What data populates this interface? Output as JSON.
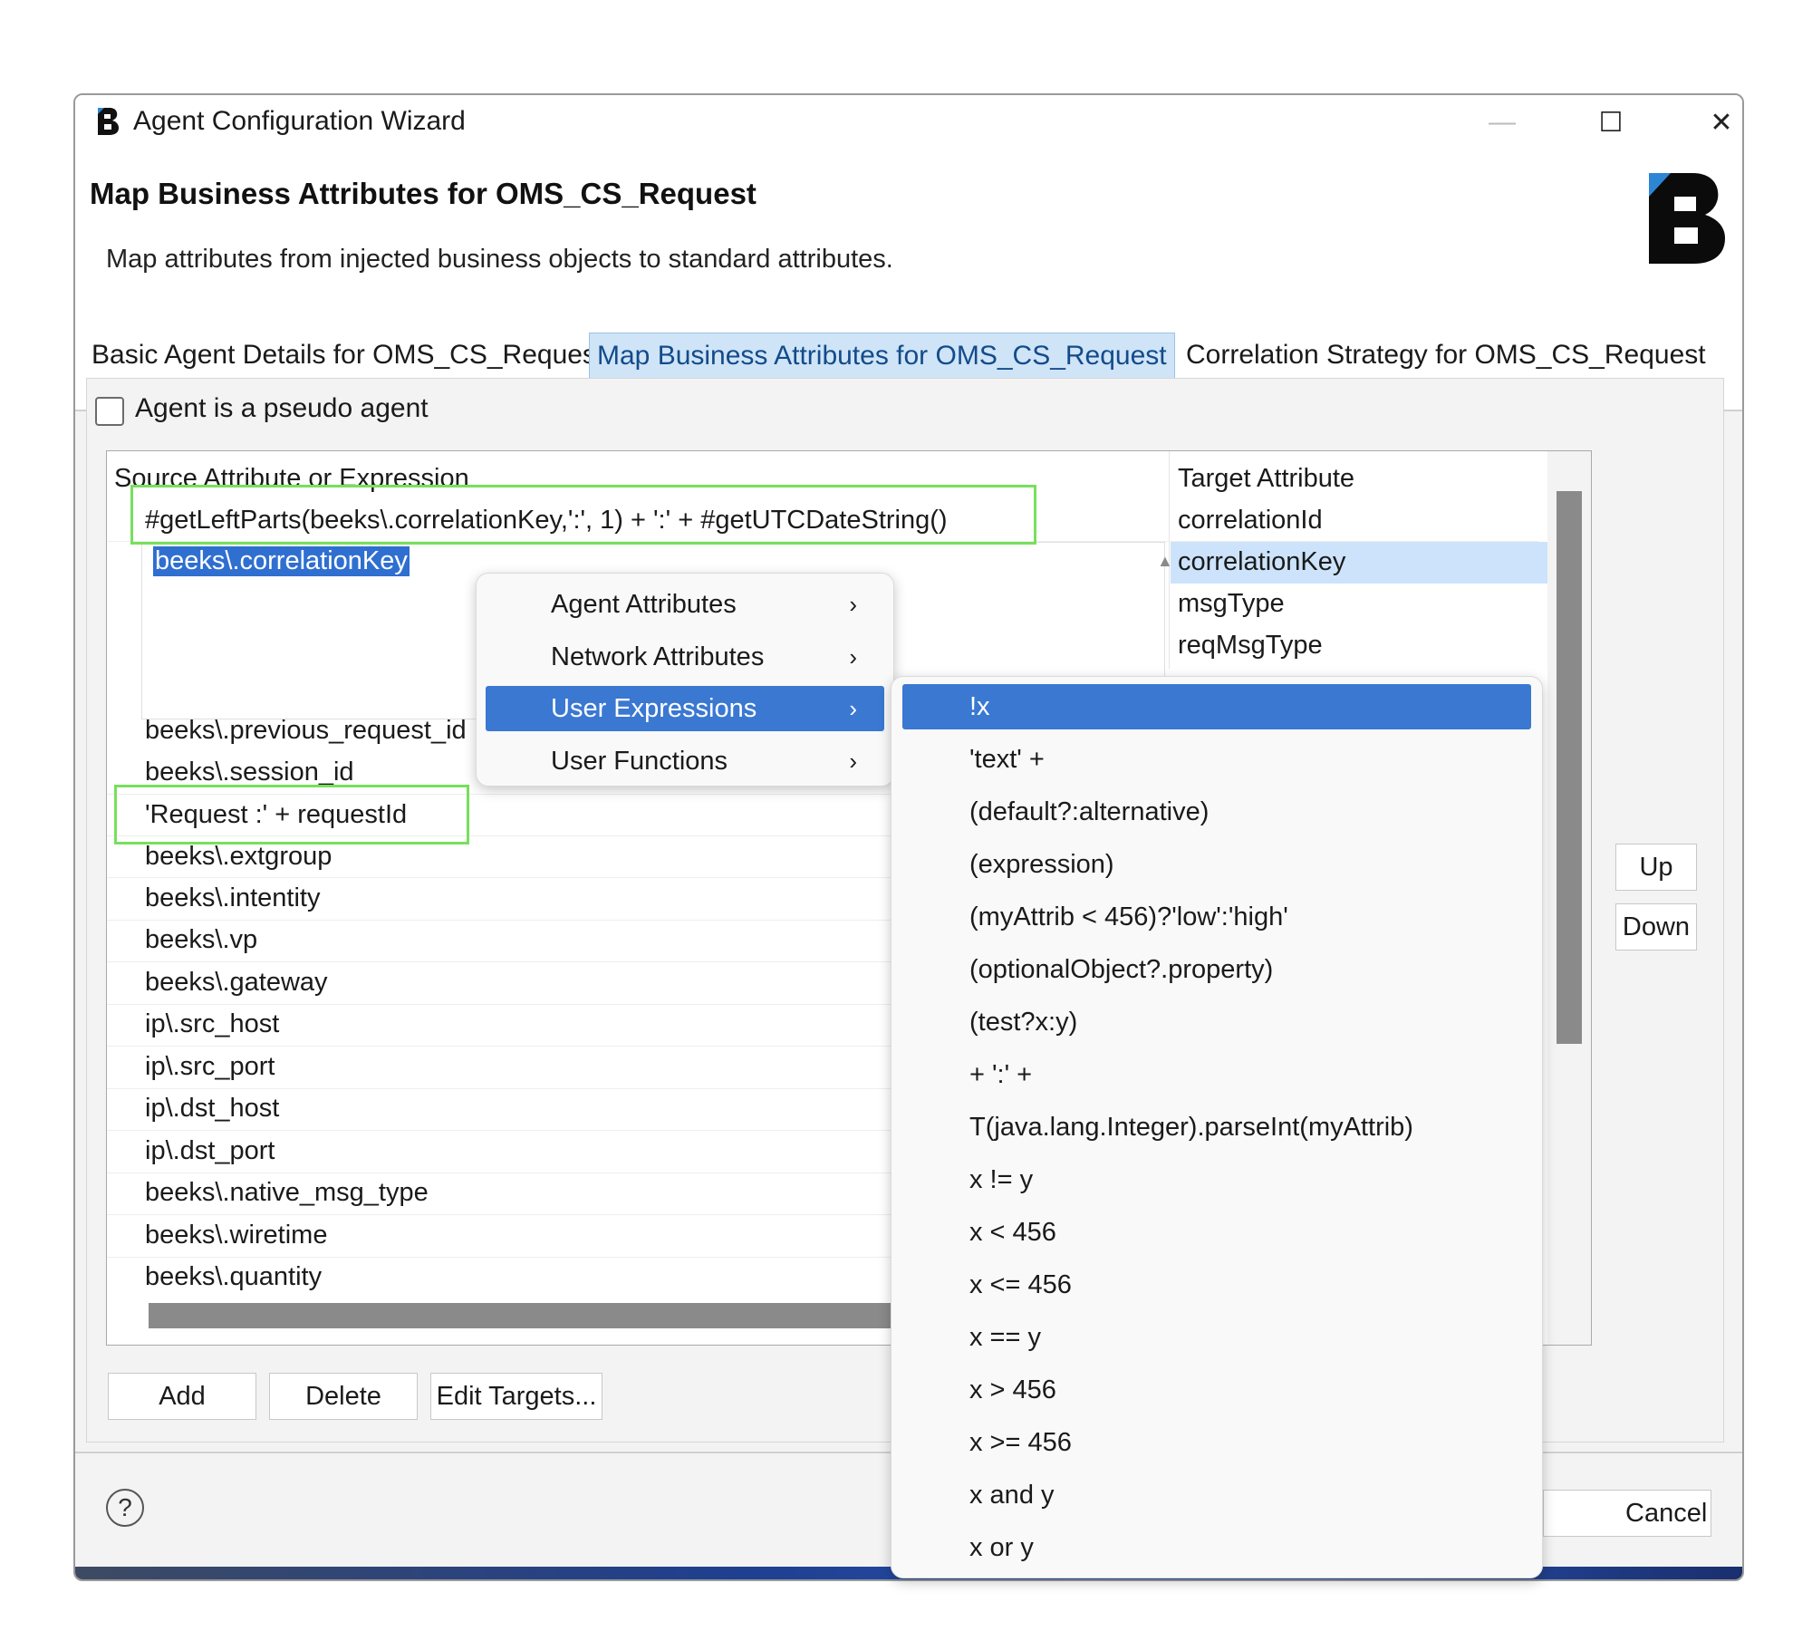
{
  "window": {
    "title": "Agent Configuration Wizard",
    "minimize_glyph": "—",
    "maximize_glyph": "☐",
    "close_glyph": "✕"
  },
  "header": {
    "heading": "Map Business Attributes for OMS_CS_Request",
    "description": "Map attributes from injected business objects to standard attributes."
  },
  "tabs": [
    {
      "label": "Basic Agent Details for OMS_CS_Request",
      "active": false
    },
    {
      "label": "Map Business Attributes for OMS_CS_Request",
      "active": true
    },
    {
      "label": "Correlation Strategy for OMS_CS_Request",
      "active": false
    }
  ],
  "pseudo_agent": {
    "label": "Agent is a pseudo agent",
    "checked": false
  },
  "table": {
    "source_header": "Source Attribute or Expression",
    "target_header": "Target Attribute",
    "rows": [
      {
        "source": "#getLeftParts(beeks\\.correlationKey,':', 1) + ':' + #getUTCDateString()",
        "target": "correlationId"
      },
      {
        "source": "beeks\\.correlationKey",
        "target": "correlationKey"
      },
      {
        "source": "",
        "target": "msgType"
      },
      {
        "source": "",
        "target": "reqMsgType"
      },
      {
        "source": "beeks\\.previous_request_id",
        "target": ""
      },
      {
        "source": "beeks\\.session_id",
        "target": ""
      },
      {
        "source": "'Request :' + requestId",
        "target": ""
      },
      {
        "source": "beeks\\.extgroup",
        "target": ""
      },
      {
        "source": "beeks\\.intentity",
        "target": ""
      },
      {
        "source": "beeks\\.vp",
        "target": ""
      },
      {
        "source": "beeks\\.gateway",
        "target": ""
      },
      {
        "source": "ip\\.src_host",
        "target": ""
      },
      {
        "source": "ip\\.src_port",
        "target": ""
      },
      {
        "source": "ip\\.dst_host",
        "target": ""
      },
      {
        "source": "ip\\.dst_port",
        "target": ""
      },
      {
        "source": "beeks\\.native_msg_type",
        "target": ""
      },
      {
        "source": "beeks\\.wiretime",
        "target": ""
      },
      {
        "source": "beeks\\.quantity",
        "target": ""
      }
    ]
  },
  "buttons": {
    "up": "Up",
    "down": "Down",
    "add": "Add",
    "delete": "Delete",
    "edit_targets": "Edit Targets...",
    "cancel": "Cancel",
    "help": "?"
  },
  "context_menu": {
    "items": [
      {
        "label": "Agent Attributes",
        "chevron": "›"
      },
      {
        "label": "Network Attributes",
        "chevron": "›"
      },
      {
        "label": "User Expressions",
        "chevron": "›",
        "highlighted": true
      },
      {
        "label": "User Functions",
        "chevron": "›"
      }
    ]
  },
  "submenu": {
    "items": [
      "!x",
      "'text' +",
      "(default?:alternative)",
      "(expression)",
      "(myAttrib < 456)?'low':'high'",
      "(optionalObject?.property)",
      "(test?x:y)",
      "+ ':' +",
      "T(java.lang.Integer).parseInt(myAttrib)",
      "x != y",
      "x < 456",
      "x <= 456",
      "x == y",
      "x > 456",
      "x >= 456",
      "x and y",
      "x or y"
    ]
  },
  "colors": {
    "highlight_box": "#77e05b",
    "selection": "#3a78d2",
    "active_tab": "#cfe4f7"
  }
}
